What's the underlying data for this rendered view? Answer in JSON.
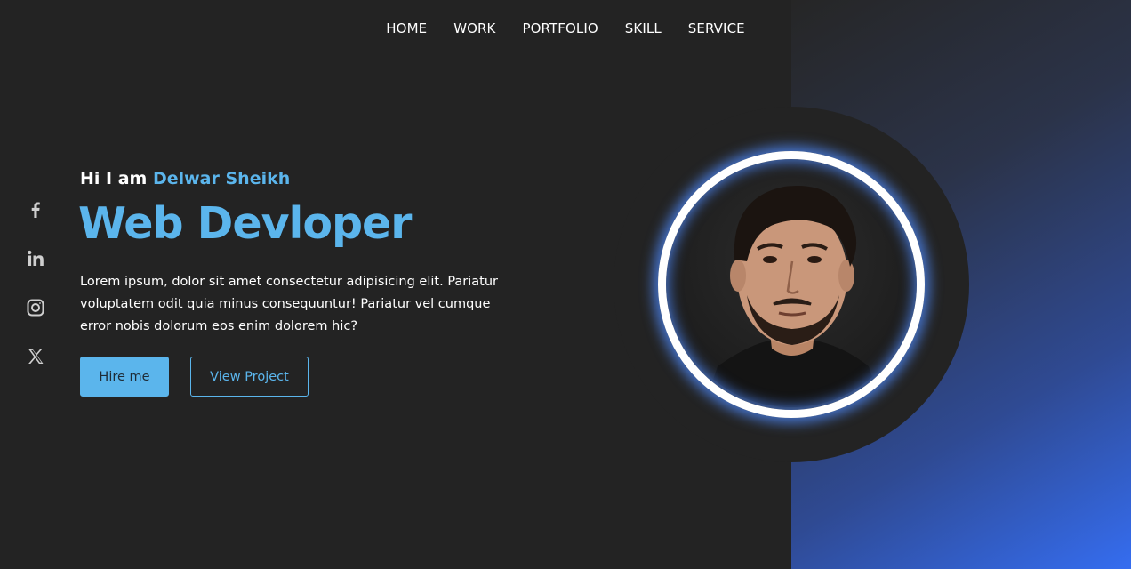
{
  "nav": {
    "items": [
      {
        "label": "HOME",
        "active": true
      },
      {
        "label": "WORK",
        "active": false
      },
      {
        "label": "PORTFOLIO",
        "active": false
      },
      {
        "label": "SKILL",
        "active": false
      },
      {
        "label": "SERVICE",
        "active": false
      }
    ]
  },
  "social": {
    "icons": [
      "facebook-icon",
      "linkedin-icon",
      "instagram-icon",
      "x-twitter-icon"
    ]
  },
  "hero": {
    "greeting_prefix": "Hi I am ",
    "name": "Delwar Sheikh",
    "role": "Web Devloper",
    "description": "Lorem ipsum, dolor sit amet consectetur adipisicing elit. Pariatur voluptatem odit quia minus consequuntur! Pariatur vel cumque error nobis dolorum eos enim dolorem hic?",
    "buttons": {
      "hire_label": "Hire me",
      "project_label": "View Project"
    }
  },
  "colors": {
    "background": "#232323",
    "accent": "#5bb5ec",
    "gradient_end": "#356df0",
    "ring": "#ffffff"
  }
}
